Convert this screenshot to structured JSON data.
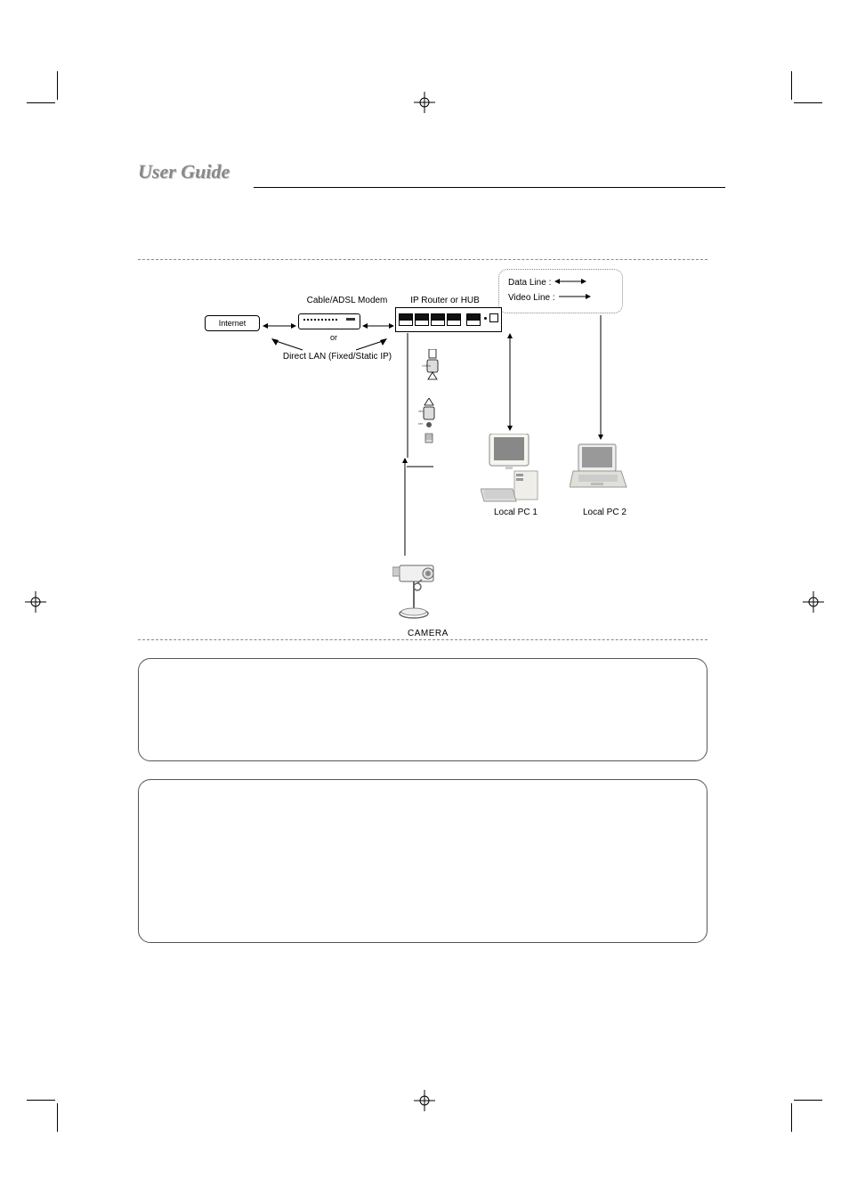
{
  "title": "User Guide",
  "legend": {
    "data_line": "Data Line :",
    "video_line": "Video Line :"
  },
  "labels": {
    "internet": "Internet",
    "modem": "Cable/ADSL Modem",
    "router": "IP Router or HUB",
    "or": "or",
    "direct_lan": "Direct LAN (Fixed/Static IP)",
    "pc1": "Local PC 1",
    "pc2": "Local PC 2",
    "camera": "CAMERA"
  },
  "router_ports": "1   2   3   4",
  "page_number": ""
}
